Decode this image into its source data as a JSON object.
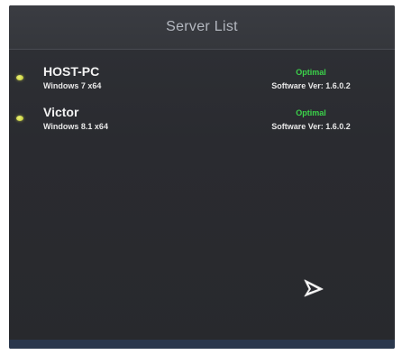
{
  "window": {
    "title": "Server List"
  },
  "servers": [
    {
      "name": "HOST-PC",
      "os": "Windows 7 x64",
      "status": "Optimal",
      "version": "Software Ver: 1.6.0.2",
      "status_color": "#3bd24a"
    },
    {
      "name": "Victor",
      "os": "Windows 8.1 x64",
      "status": "Optimal",
      "version": "Software Ver: 1.6.0.2",
      "status_color": "#3bd24a"
    }
  ],
  "icons": {
    "status_indicator": "status-dot-icon",
    "pointer": "mouse-pointer-icon"
  },
  "colors": {
    "background": "#2b2c31",
    "titlebar": "#37393e",
    "status_optimal": "#3bd24a",
    "indicator": "#d9e04a"
  }
}
